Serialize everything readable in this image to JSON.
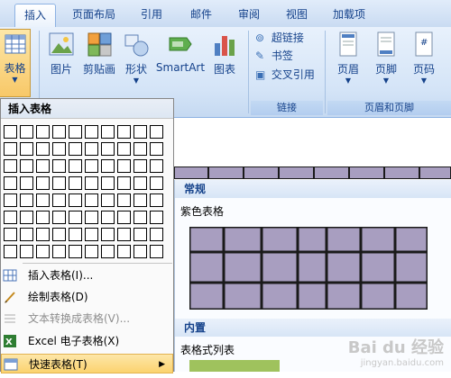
{
  "tabs": [
    {
      "label": "插入",
      "active": true
    },
    {
      "label": "页面布局",
      "active": false
    },
    {
      "label": "引用",
      "active": false
    },
    {
      "label": "邮件",
      "active": false
    },
    {
      "label": "审阅",
      "active": false
    },
    {
      "label": "视图",
      "active": false
    },
    {
      "label": "加载项",
      "active": false
    }
  ],
  "ribbon": {
    "table_button": "表格",
    "picture_button": "图片",
    "clipart_button": "剪贴画",
    "shapes_button": "形状",
    "smartart_button": "SmartArt",
    "chart_button": "图表",
    "hyperlink_button": "超链接",
    "bookmark_button": "书签",
    "crossref_button": "交叉引用",
    "links_group": "链接",
    "header_button": "页眉",
    "footer_button": "页脚",
    "pagenum_button": "页码",
    "header_footer_group": "页眉和页脚"
  },
  "menu": {
    "title": "插入表格",
    "grid_cols": 10,
    "grid_rows": 8,
    "items": [
      {
        "label": "插入表格(I)...",
        "disabled": false,
        "icon": "insert-table-icon"
      },
      {
        "label": "绘制表格(D)",
        "disabled": false,
        "icon": "draw-table-icon"
      },
      {
        "label": "文本转换成表格(V)...",
        "disabled": true,
        "icon": "convert-text-icon"
      },
      {
        "label": "Excel 电子表格(X)",
        "disabled": false,
        "icon": "excel-icon"
      },
      {
        "label": "快速表格(T)",
        "disabled": false,
        "icon": "quick-table-icon",
        "submenu": true,
        "highlighted": true
      }
    ]
  },
  "gallery": {
    "section_regular": "常规",
    "item_purple": "紫色表格",
    "section_builtin": "内置",
    "item_tabular": "表格式列表",
    "table_color": "#a89ec0",
    "table_border": "#1a1a1a"
  },
  "watermark": {
    "brand": "Bai du 经验",
    "url": "jingyan.baidu.com"
  },
  "colors": {
    "accent": "#15428b",
    "ribbon_bg": "#d4e4f7",
    "hover": "#fbd36f"
  }
}
